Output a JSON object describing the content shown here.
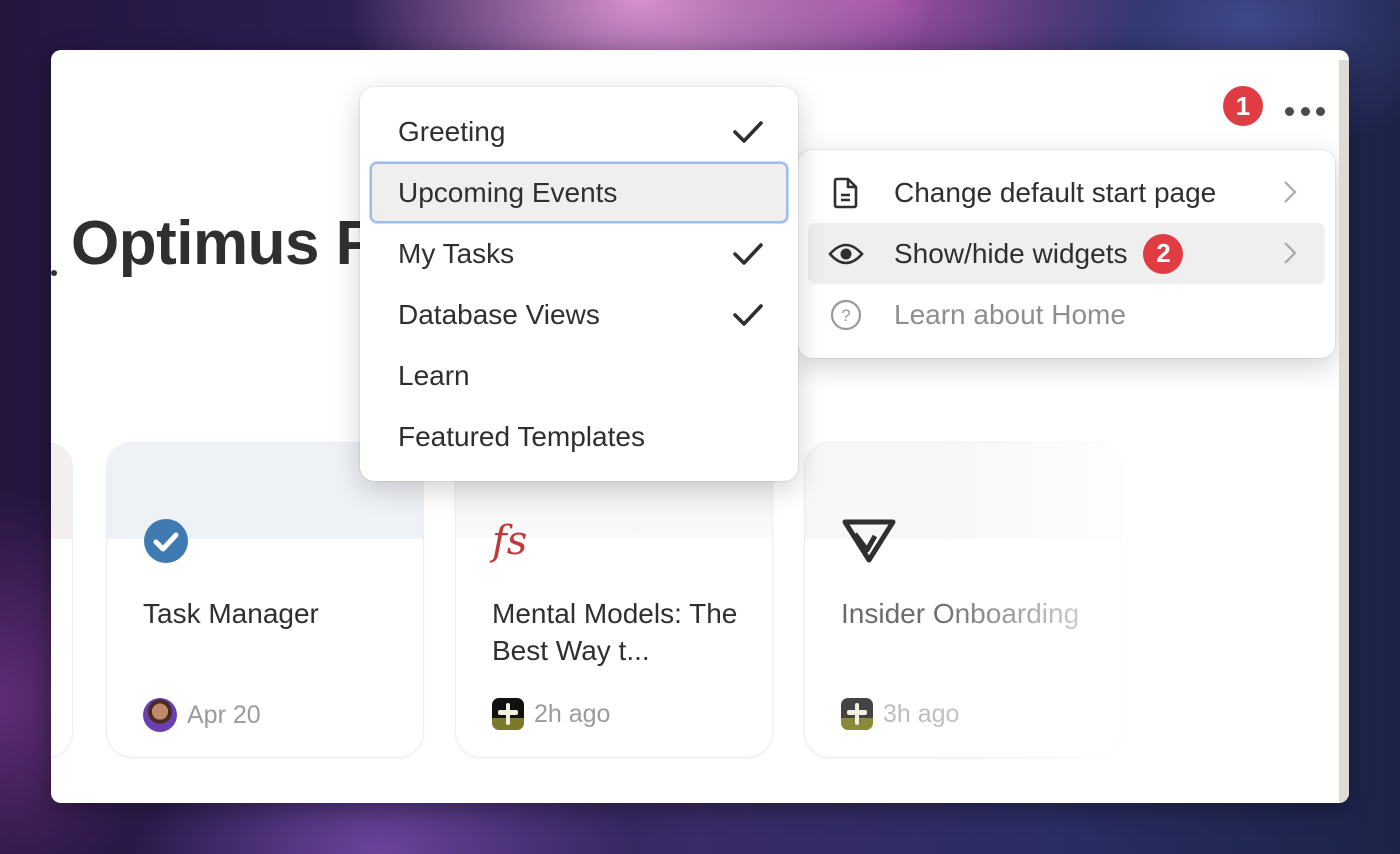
{
  "page": {
    "title": "Optimus P"
  },
  "header": {
    "annotation_1": "1",
    "more_label": "More options"
  },
  "options_menu": {
    "items": [
      {
        "label": "Change default start page",
        "icon": "document-icon",
        "has_submenu": true
      },
      {
        "label": "Show/hide widgets",
        "icon": "eye-icon",
        "has_submenu": true,
        "annotation": "2"
      },
      {
        "label": "Learn about Home",
        "icon": "question-circle-icon",
        "has_submenu": false
      }
    ]
  },
  "widgets_menu": {
    "items": [
      {
        "label": "Greeting",
        "checked": true
      },
      {
        "label": "Upcoming Events",
        "checked": false,
        "focused": true
      },
      {
        "label": "My Tasks",
        "checked": true
      },
      {
        "label": "Database Views",
        "checked": true
      },
      {
        "label": "Learn",
        "checked": false
      },
      {
        "label": "Featured Templates",
        "checked": false
      }
    ]
  },
  "cards": [
    {
      "title": "Task Manager",
      "icon": "check-circle-icon",
      "meta": "Apr 20",
      "meta_icon": "avatar",
      "cover_color": "#eef1f5"
    },
    {
      "title": "Mental Models: The Best Way t...",
      "icon": "fs-logo-icon",
      "icon_text": "fs",
      "meta": "2h ago",
      "meta_icon": "app-icon",
      "cover_color": "#f3f3f3"
    },
    {
      "title": "Insider Onboarding",
      "icon": "triangle-logo-icon",
      "meta": "3h ago",
      "meta_icon": "app-icon",
      "cover_color": "#f6f6f6"
    }
  ],
  "colors": {
    "annotation_badge": "#e03c44",
    "focus_ring": "#9fbde8",
    "check_icon_bg": "#3f7bb0",
    "fs_logo": "#c0393b"
  }
}
